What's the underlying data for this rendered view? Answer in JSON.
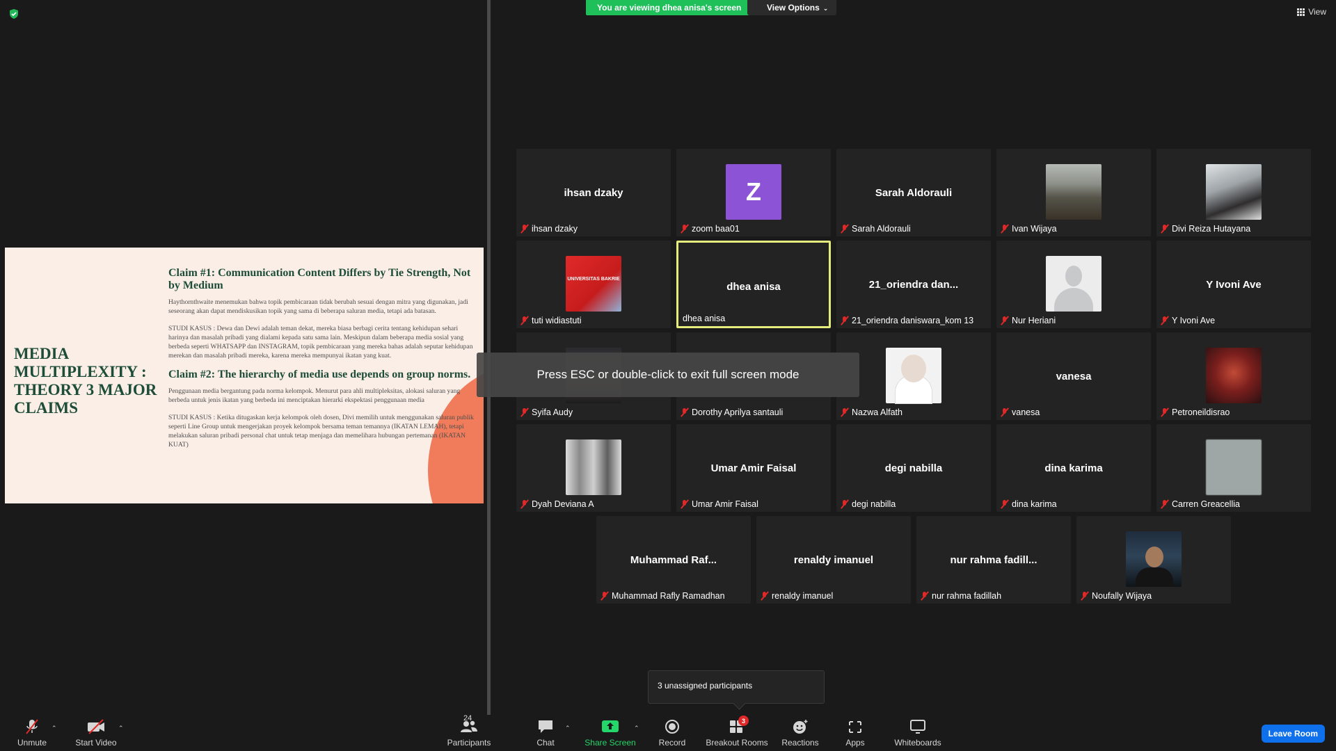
{
  "banner": {
    "viewing_text": "You are viewing dhea anisa's screen",
    "view_options_label": "View Options",
    "view_label": "View"
  },
  "slide": {
    "title": "MEDIA MULTIPLEXITY : THEORY 3 MAJOR CLAIMS",
    "claim1_heading": "Claim #1: Communication Content Differs by Tie Strength, Not by Medium",
    "claim1_text": "Haythornthwaite menemukan bahwa topik pembicaraan tidak berubah sesuai dengan mitra yang digunakan, jadi seseorang akan dapat mendiskusikan topik yang sama di beberapa saluran media, tetapi ada batasan.",
    "claim1_case": "STUDI KASUS : Dewa dan Dewi adalah teman dekat, mereka biasa berbagi cerita tentang kehidupan sehari harinya dan masalah pribadi yang dialami kepada satu sama lain. Meskipun dalam beberapa media sosial yang berbeda seperti WHATSAPP dan INSTAGRAM, topik pembicaraan yang mereka bahas adalah seputar kehidupan merekan dan masalah pribadi mereka, karena mereka mempunyai ikatan yang kuat.",
    "claim2_heading": "Claim #2: The hierarchy of media use depends on group norms.",
    "claim2_text": "Penggunaan media bergantung pada norma kelompok. Menurut para ahli multipleksitas, alokasi saluran yang berbeda untuk jenis ikatan yang berbeda ini menciptakan hierarki ekspektasi penggunaan media",
    "claim2_case": "STUDI KASUS : Ketika ditugaskan kerja kelompok oleh dosen, Divi memilih untuk menggunakan saluran publik seperti Line Group untuk mengerjakan proyek kelompok bersama teman temannya (IKATAN LEMAH), tetapi melakukan saluran pribadi personal chat untuk tetap menjaga dan memelihara hubungan pertemanan (IKATAN KUAT)"
  },
  "participants": [
    {
      "tile_text": "ihsan dzaky",
      "name": "ihsan dzaky",
      "type": "text"
    },
    {
      "tile_text": "Z",
      "name": "zoom baa01",
      "type": "pic",
      "pic": "z"
    },
    {
      "tile_text": "Sarah Aldorauli",
      "name": "Sarah Aldorauli",
      "type": "text"
    },
    {
      "tile_text": "",
      "name": "Ivan Wijaya",
      "type": "pic",
      "pic": "ivan"
    },
    {
      "tile_text": "",
      "name": "Divi Reiza Hutayana",
      "type": "pic",
      "pic": "divi"
    },
    {
      "tile_text": "UNIVERSITAS BAKRIE",
      "name": "tuti widiastuti",
      "type": "pic",
      "pic": "tuti"
    },
    {
      "tile_text": "dhea anisa",
      "name": "dhea anisa",
      "type": "text",
      "active": true
    },
    {
      "tile_text": "21_oriendra  dan...",
      "name": "21_oriendra daniswara_kom 13",
      "type": "text"
    },
    {
      "tile_text": "",
      "name": "Nur Heriani",
      "type": "pic",
      "pic": "nur"
    },
    {
      "tile_text": "Y Ivoni Ave",
      "name": "Y Ivoni Ave",
      "type": "text"
    },
    {
      "tile_text": "",
      "name": "Syifa Audy",
      "type": "pic",
      "pic": "syifa"
    },
    {
      "tile_text": "",
      "name": "Dorothy Aprilya santauli",
      "type": "text"
    },
    {
      "tile_text": "",
      "name": "Nazwa Alfath",
      "type": "pic",
      "pic": "nazwa"
    },
    {
      "tile_text": "vanesa",
      "name": "vanesa",
      "type": "text"
    },
    {
      "tile_text": "",
      "name": "Petroneildisrao",
      "type": "pic",
      "pic": "petro"
    },
    {
      "tile_text": "",
      "name": "Dyah Deviana A",
      "type": "pic",
      "pic": "dyah"
    },
    {
      "tile_text": "Umar Amir Faisal",
      "name": "Umar Amir Faisal",
      "type": "text"
    },
    {
      "tile_text": "degi nabilla",
      "name": "degi nabilla",
      "type": "text"
    },
    {
      "tile_text": "dina karima",
      "name": "dina karima",
      "type": "text"
    },
    {
      "tile_text": "",
      "name": "Carren Greacellia",
      "type": "pic",
      "pic": "carren"
    },
    {
      "tile_text": "Muhammad  Raf...",
      "name": "Muhammad Rafly Ramadhan",
      "type": "text"
    },
    {
      "tile_text": "renaldy imanuel",
      "name": "renaldy imanuel",
      "type": "text"
    },
    {
      "tile_text": "nur  rahma  fadill...",
      "name": "nur rahma fadillah",
      "type": "text"
    },
    {
      "tile_text": "",
      "name": "Noufally Wijaya",
      "type": "pic",
      "pic": "noufally"
    }
  ],
  "toast": "Press ESC or double-click to exit full screen mode",
  "unassigned": "3 unassigned participants",
  "toolbar": {
    "unmute": "Unmute",
    "start_video": "Start Video",
    "participants": "Participants",
    "participants_count": "24",
    "chat": "Chat",
    "share_screen": "Share Screen",
    "record": "Record",
    "breakout_rooms": "Breakout Rooms",
    "breakout_badge": "3",
    "reactions": "Reactions",
    "apps": "Apps",
    "whiteboards": "Whiteboards",
    "leave_room": "Leave Room"
  },
  "colors": {
    "banner_green": "#1fbf5a",
    "active_speaker": "#e4ec7e",
    "leave_blue": "#0e71eb",
    "muted_red": "#e02828"
  }
}
